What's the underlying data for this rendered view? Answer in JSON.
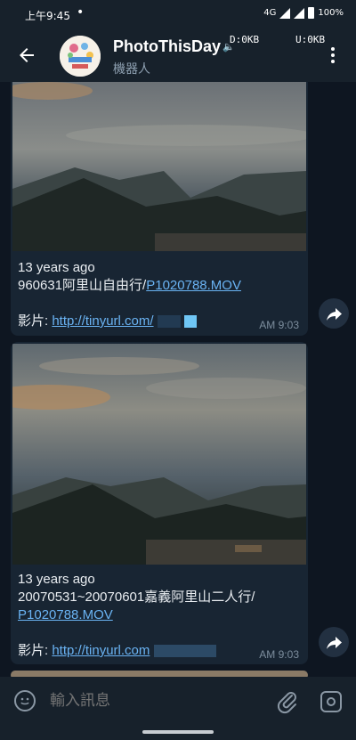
{
  "status_bar": {
    "time": "上午9:45",
    "network": "4G",
    "battery": "100%"
  },
  "header": {
    "title": "PhotoThisDay",
    "subtitle": "機器人",
    "net_down": "D:0KB",
    "net_up": "U:0KB"
  },
  "messages": [
    {
      "ago": "13 years ago",
      "caption_prefix": "960631阿里山自由行/",
      "caption_link": "P1020788.MOV",
      "video_label": "影片: ",
      "video_link": "http://tinyurl.com/",
      "time": "AM 9:03"
    },
    {
      "ago": "13 years ago",
      "caption_prefix": "20070531~20070601嘉義阿里山二人行/",
      "caption_link": "P1020788.MOV",
      "video_label": "影片: ",
      "video_link": "http://tinyurl.com",
      "time": "AM 9:03"
    }
  ],
  "input": {
    "placeholder": "輸入訊息"
  },
  "colors": {
    "background": "#0e1621",
    "bubble": "#182533",
    "bar": "#17212b",
    "link": "#6ab3f3"
  },
  "icons": [
    "back-arrow-icon",
    "more-vert-icon",
    "share-icon",
    "emoji-icon",
    "attach-icon",
    "camera-icon",
    "mute-icon"
  ]
}
